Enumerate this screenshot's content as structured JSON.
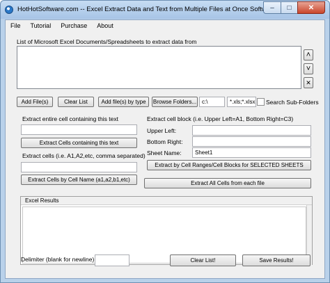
{
  "window": {
    "title": "HotHotSoftware.com -- Excel Extract Data and Text from Multiple Files at Once Software",
    "min_glyph": "–",
    "max_glyph": "□",
    "close_glyph": "✕"
  },
  "menu": {
    "file": "File",
    "tutorial": "Tutorial",
    "purchase": "Purchase",
    "about": "About"
  },
  "files": {
    "list_label": "List of Microsoft Excel Documents/Spreadsheets to extract data from",
    "up_glyph": "˄",
    "down_glyph": "˅",
    "remove_glyph": "✕",
    "add_files": "Add File(s)",
    "clear_list": "Clear List",
    "add_by_type": "Add file(s) by type",
    "browse_folders": "Browse Folders...",
    "folder_path": "c:\\",
    "file_types": "*.xls;*.xlsx",
    "search_subfolders": "Search Sub-Folders"
  },
  "extract_text": {
    "label": "Extract entire cell containing this text",
    "value": "",
    "button": "Extract Cells containing this text"
  },
  "extract_cells": {
    "label": "Extract cells (i.e. A1,A2,etc, comma separated)",
    "value": "",
    "button": "Extract Cells by Cell Name (a1,a2,b1,etc)"
  },
  "extract_block": {
    "label": "Extract cell block (i.e. Upper Left=A1, Bottom Right=C3)",
    "upper_left_label": "Upper Left:",
    "upper_left_value": "",
    "bottom_right_label": "Bottom Right:",
    "bottom_right_value": "",
    "sheet_name_label": "Sheet Name:",
    "sheet_name_value": "Sheet1",
    "button_ranges": "Extract by Cell Ranges/Cell Blocks for SELECTED SHEETS",
    "button_all": "Extract All Cells from each file"
  },
  "results": {
    "header": "Excel Results",
    "delimiter_label": "Delimiter (blank for newline)",
    "delimiter_value": "",
    "clear_button": "Clear List!",
    "save_button": "Save Results!"
  }
}
